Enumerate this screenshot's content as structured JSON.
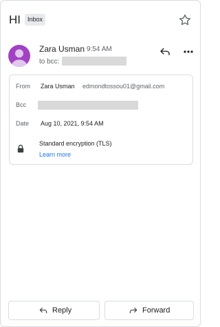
{
  "message": {
    "subject": "HI",
    "label_badge": "Inbox"
  },
  "sender": {
    "name": "Zara Usman",
    "time": "9:54 AM",
    "to_prefix": "to bcc:",
    "avatar_color": "#a142c4"
  },
  "details": {
    "from_label": "From",
    "from_name": "Zara Usman",
    "from_email": "edmondtossou01@gmail.com",
    "bcc_label": "Bcc",
    "date_label": "Date",
    "date_value": "Aug 10, 2021, 9:54 AM",
    "encryption": "Standard encryption (TLS)",
    "learn_more": "Learn more"
  },
  "actions": {
    "reply": "Reply",
    "forward": "Forward"
  },
  "icons": {
    "star": "star-icon",
    "reply": "reply-icon",
    "more": "more-vert-icon",
    "lock": "lock-icon",
    "forward": "forward-icon"
  },
  "colors": {
    "link": "#1a73e8",
    "redaction": "#d9d9d9"
  }
}
